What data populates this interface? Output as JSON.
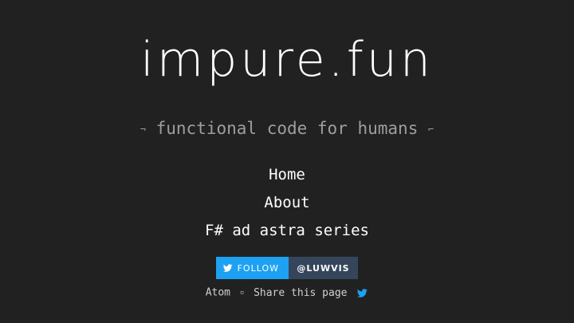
{
  "site": {
    "title": "impure.fun",
    "tagline": "functional code for humans",
    "tagline_open": "¬",
    "tagline_close": "⌐"
  },
  "nav": {
    "items": [
      {
        "label": "Home"
      },
      {
        "label": "About"
      },
      {
        "label": "F# ad astra series"
      }
    ]
  },
  "twitter_button": {
    "follow_label": "FOLLOW",
    "handle": "@LUWVIS",
    "icon": "twitter-bird-icon"
  },
  "footer": {
    "atom_label": "Atom",
    "separator": "▫",
    "share_label": "Share this page",
    "share_icon": "twitter-bird-icon"
  },
  "colors": {
    "background": "#212121",
    "text": "#ffffff",
    "tagline": "#9e9e9e",
    "twitter_blue": "#1da1f2",
    "twitter_dark": "#35465c"
  }
}
